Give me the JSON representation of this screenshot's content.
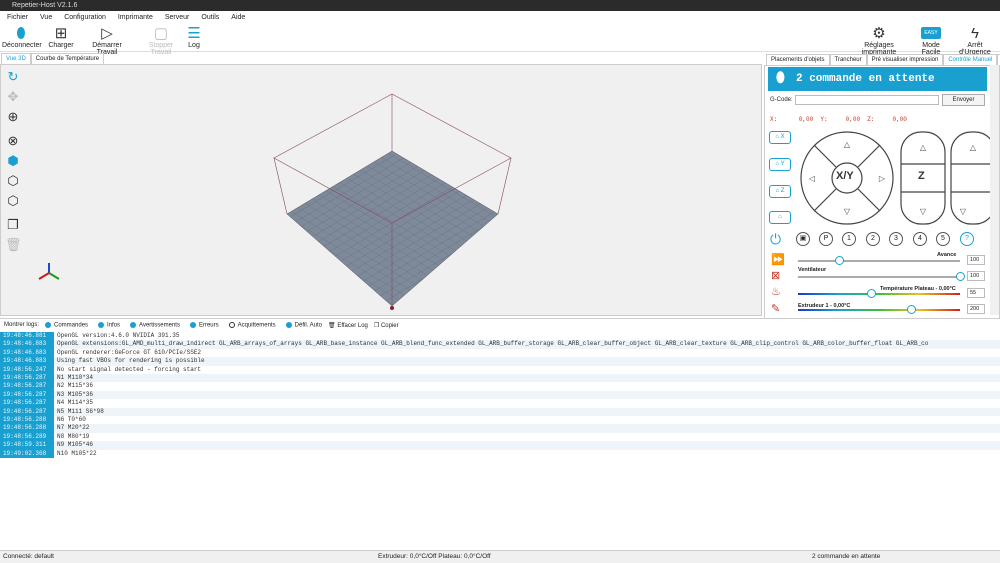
{
  "app": {
    "title": "Repetier-Host V2.1.6"
  },
  "menu": [
    "Fichier",
    "Vue",
    "Configuration",
    "Imprimante",
    "Serveur",
    "Outils",
    "Aide"
  ],
  "toolbar": {
    "disconnect": "Déconnecter",
    "load": "Charger",
    "start": "Démarrer Travail",
    "stop": "Stopper Travail",
    "log": "Log",
    "printer_settings": "Réglages imprimante",
    "easy_mode": "Mode Facile",
    "easy_badge": "EASY",
    "emergency": "Arrêt d'Urgence"
  },
  "left_tabs": [
    "Vue 3D",
    "Courbe de Température"
  ],
  "right_tabs": [
    "Placements d'objets",
    "Trancheur",
    "Pré visualiser impression",
    "Contrôle Manuel",
    "C"
  ],
  "manual": {
    "banner": "2 commande en attente",
    "gcode_label": "G-Code:",
    "gcode_value": "",
    "send": "Envoyer",
    "x_label": "X:",
    "x": "0,00",
    "y_label": "Y:",
    "y": "0,00",
    "z_label": "Z:",
    "z": "0,00",
    "home_x": "X",
    "home_y": "Y",
    "home_z": "Z",
    "xy": "X/Y",
    "z_btn": "Z",
    "buttons": [
      "P",
      "1",
      "2",
      "3",
      "4",
      "5",
      "?"
    ],
    "feed_label": "Avance",
    "feed": "100",
    "feed_level": 0.25,
    "fan_label": "Ventilateur",
    "fan": "100",
    "fan_level": 1.0,
    "bed_label": "Température Plateau - 0,00°C",
    "bed": "55",
    "bed_level": 0.45,
    "ext_label": "Extrudeur 1 - 0,00°C",
    "ext": "200",
    "ext_level": 0.7
  },
  "logbar": {
    "label": "Montrer logs:",
    "filters": [
      {
        "label": "Commandes",
        "on": true
      },
      {
        "label": "Infos",
        "on": true
      },
      {
        "label": "Avertissements",
        "on": true
      },
      {
        "label": "Erreurs",
        "on": true
      },
      {
        "label": "Acquittements",
        "on": false
      },
      {
        "label": "Défil. Auto",
        "on": true
      }
    ],
    "clear": "Effacer Log",
    "copy": "Copier"
  },
  "log": [
    {
      "t": "19:48:46.881",
      "m": "OpenGL version:4.6.0 NVIDIA 391.35"
    },
    {
      "t": "19:48:46.883",
      "m": "OpenGL extensions:GL_AMD_multi_draw_indirect GL_ARB_arrays_of_arrays GL_ARB_base_instance GL_ARB_blend_func_extended GL_ARB_buffer_storage GL_ARB_clear_buffer_object GL_ARB_clear_texture GL_ARB_clip_control GL_ARB_color_buffer_float GL_ARB_co"
    },
    {
      "t": "19:48:46.883",
      "m": "OpenGL renderer:GeForce GT 610/PCIe/SSE2"
    },
    {
      "t": "19:48:46.883",
      "m": "Using fast VBOs for rendering is possible"
    },
    {
      "t": "19:48:56.247",
      "m": "No start signal detected - forcing start"
    },
    {
      "t": "19:48:56.287",
      "m": "N1 M110*34"
    },
    {
      "t": "19:48:56.287",
      "m": "N2 M115*36"
    },
    {
      "t": "19:48:56.287",
      "m": "N3 M105*36"
    },
    {
      "t": "19:48:56.287",
      "m": "N4 M114*35"
    },
    {
      "t": "19:48:56.287",
      "m": "N5 M111 S6*98"
    },
    {
      "t": "19:48:56.288",
      "m": "N6 T0*60"
    },
    {
      "t": "19:48:56.288",
      "m": "N7 M20*22"
    },
    {
      "t": "19:48:56.289",
      "m": "N8 M80*19"
    },
    {
      "t": "19:48:59.311",
      "m": "N9 M105*46"
    },
    {
      "t": "19:49:02.368",
      "m": "N10 M105*22"
    }
  ],
  "status": {
    "connection": "Connecté: default",
    "temps": "Extrudeur: 0,0°C/Off Plateau: 0,0°C/Off",
    "queue": "2 commande en attente"
  },
  "colors": {
    "accent": "#1aa0d0",
    "coords": "#c0392b"
  }
}
